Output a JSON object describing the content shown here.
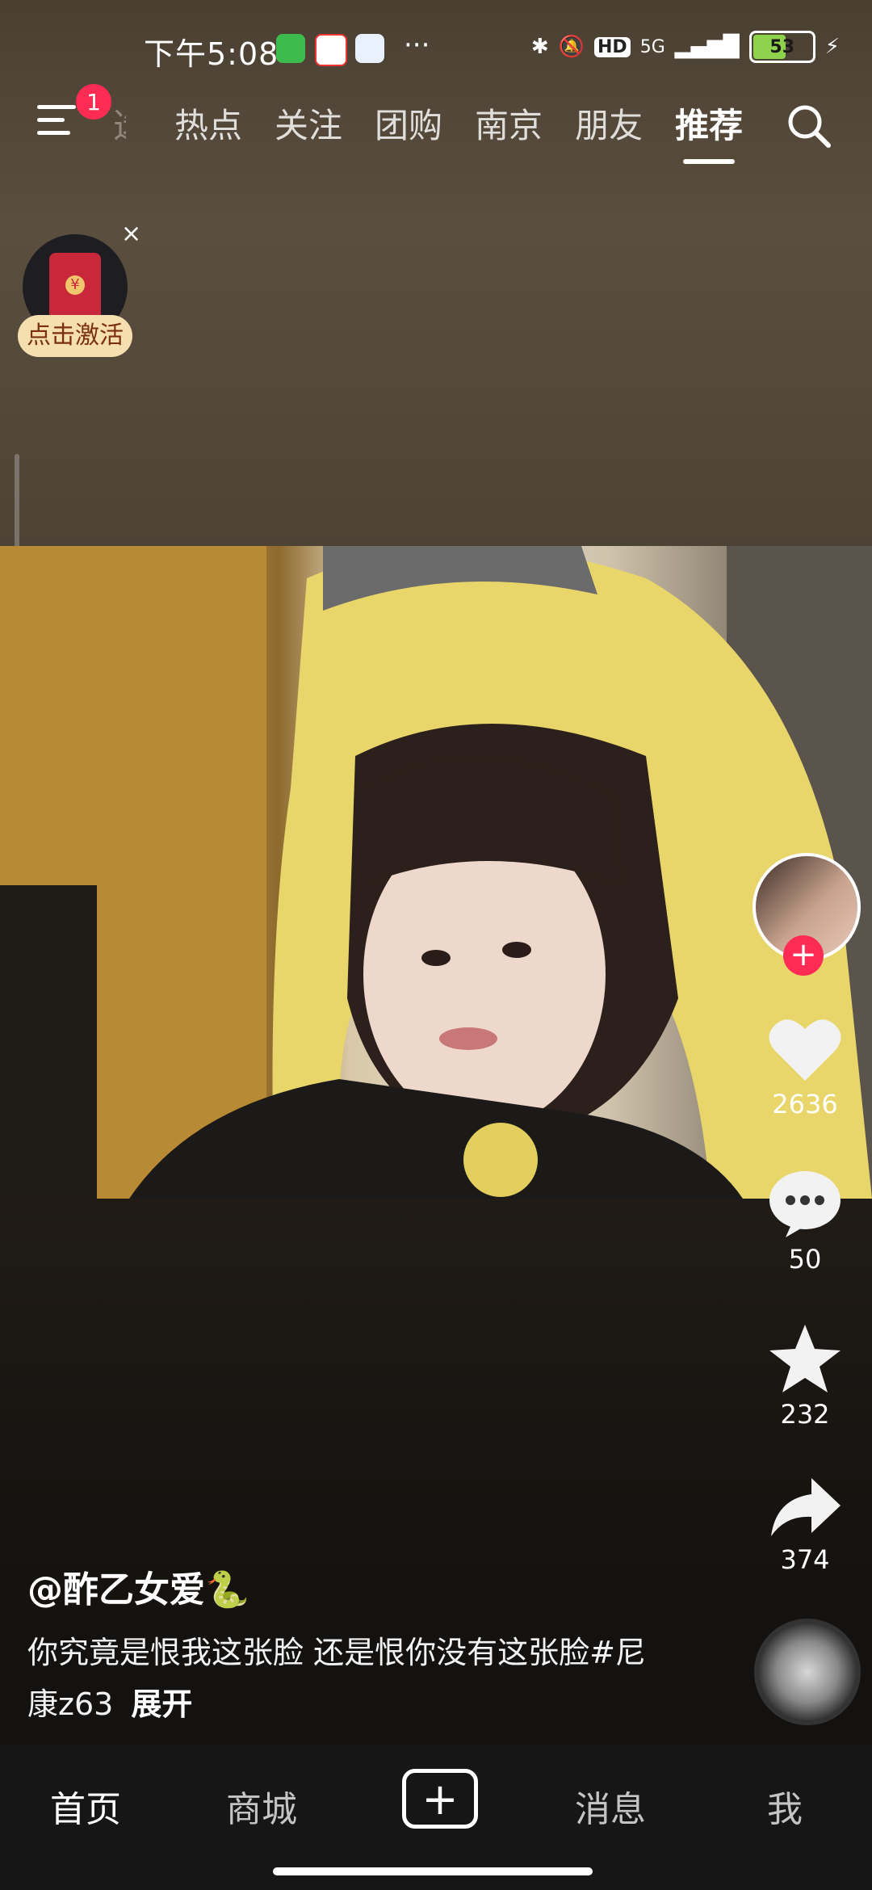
{
  "status_bar": {
    "time": "下午5:08",
    "app_icons": [
      "wechat-like-icon",
      "58-app-icon",
      "baidu-cloud-icon"
    ],
    "more": "···",
    "network": "5G",
    "hd": "HD",
    "battery": "53"
  },
  "top_nav": {
    "notification_count": "1",
    "tabs": [
      "选",
      "热点",
      "关注",
      "团购",
      "南京",
      "朋友",
      "推荐"
    ],
    "active_tab": "推荐"
  },
  "red_packet": {
    "label": "点击激活",
    "close": "×"
  },
  "actions": {
    "likes": "2636",
    "comments": "50",
    "favorites": "232",
    "shares": "374"
  },
  "post": {
    "author": "@酢乙女爱🐍",
    "caption": "你究竟是恨我这张脸 还是恨你没有这张脸#尼康z63",
    "expand": "展开"
  },
  "bottom_nav": {
    "items": [
      "首页",
      "商城",
      "消息",
      "我"
    ],
    "plus": "+"
  },
  "colors": {
    "accent": "#fe2c55",
    "redpacket_label_bg": "#f5dfb0"
  }
}
